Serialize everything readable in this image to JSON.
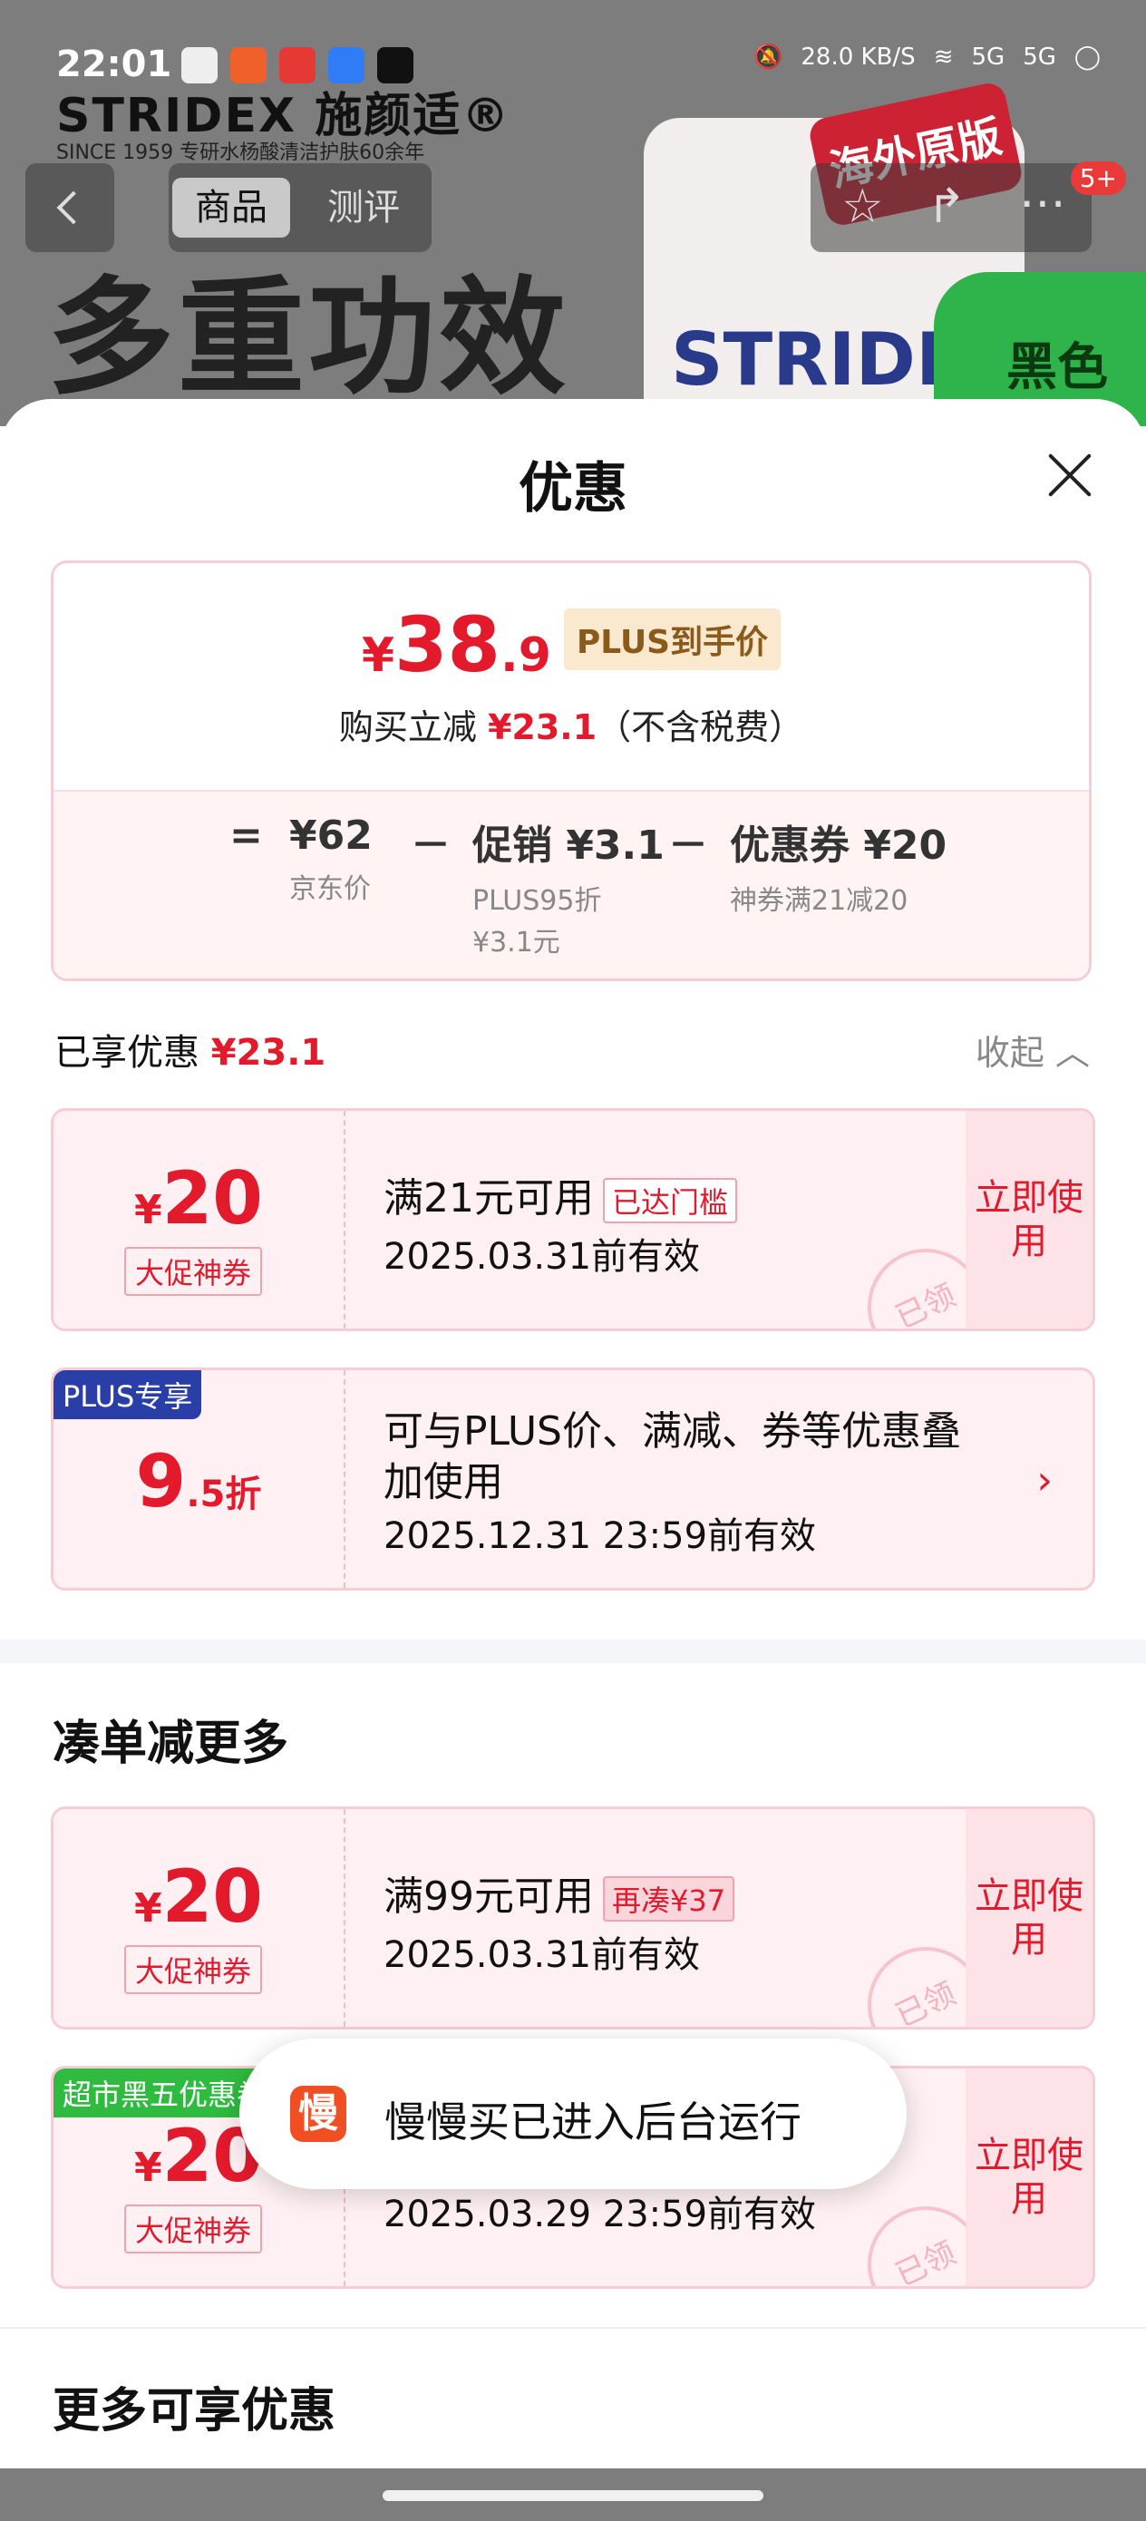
{
  "status_bar": {
    "time": "22:01",
    "speed": "28.0 KB/S",
    "network1": "5G",
    "network2": "5G"
  },
  "background": {
    "brand": "STRIDEX 施颜适®",
    "brand_sub": "SINCE 1959 专研水杨酸清洁护肤60余年",
    "tabs": [
      "商品",
      "测评"
    ],
    "headline": "多重功效",
    "badge": "5+",
    "stamp": "海外原版",
    "green_label": "黑色",
    "product_label": "STRIDEX"
  },
  "sheet": {
    "title": "优惠",
    "summary": {
      "yen": "¥",
      "price_int": "38",
      "price_dec": ".9",
      "plus_tag": "PLUS到手价",
      "sub_prefix": "购买立减",
      "sub_amount": "¥23.1",
      "sub_suffix": "（不含税费）",
      "eq": "=",
      "minus": "－",
      "jd_price": "¥62",
      "jd_label": "京东价",
      "promo_title": "促销 ¥3.1",
      "promo_note1": "PLUS95折",
      "promo_note2": "¥3.1元",
      "coupon_title": "优惠券 ¥20",
      "coupon_note": "神券满21减20"
    },
    "enjoyed_label": "已享优惠",
    "enjoyed_amount": "¥23.1",
    "collapse_label": "收起 ︿",
    "coupons_enjoyed": [
      {
        "yen": "¥",
        "amount": "20",
        "type": "大促神券",
        "cond": "满21元可用",
        "tag": "已达门槛",
        "date": "2025.03.31前有效",
        "action": "立即使用",
        "stamp": "已领"
      },
      {
        "ribbon": "PLUS专享",
        "discount": "9",
        "discount_small": ".5折",
        "cond": "可与PLUS价、满减、券等优惠叠加使用",
        "date": "2025.12.31 23:59前有效",
        "chevron": "›"
      }
    ],
    "section_more": "凑单减更多",
    "coupons_more": [
      {
        "yen": "¥",
        "amount": "20",
        "type": "大促神券",
        "cond": "满99元可用",
        "tag": "再凑¥37",
        "date": "2025.03.31前有效",
        "action": "立即使用",
        "stamp": "已领"
      },
      {
        "ribbon": "超市黑五优惠券",
        "yen": "¥",
        "amount": "20",
        "type": "大促神券",
        "date": "2025.03.29 23:59前有效",
        "action": "立即使用",
        "stamp": "已领"
      }
    ],
    "section_extra": "更多可享优惠"
  },
  "toast": {
    "icon_char": "慢",
    "text": "慢慢买已进入后台运行"
  },
  "colors": {
    "accent": "#e21a2c",
    "plus_blue": "#2a3ea8",
    "green_ribbon": "#2fbb3f"
  }
}
